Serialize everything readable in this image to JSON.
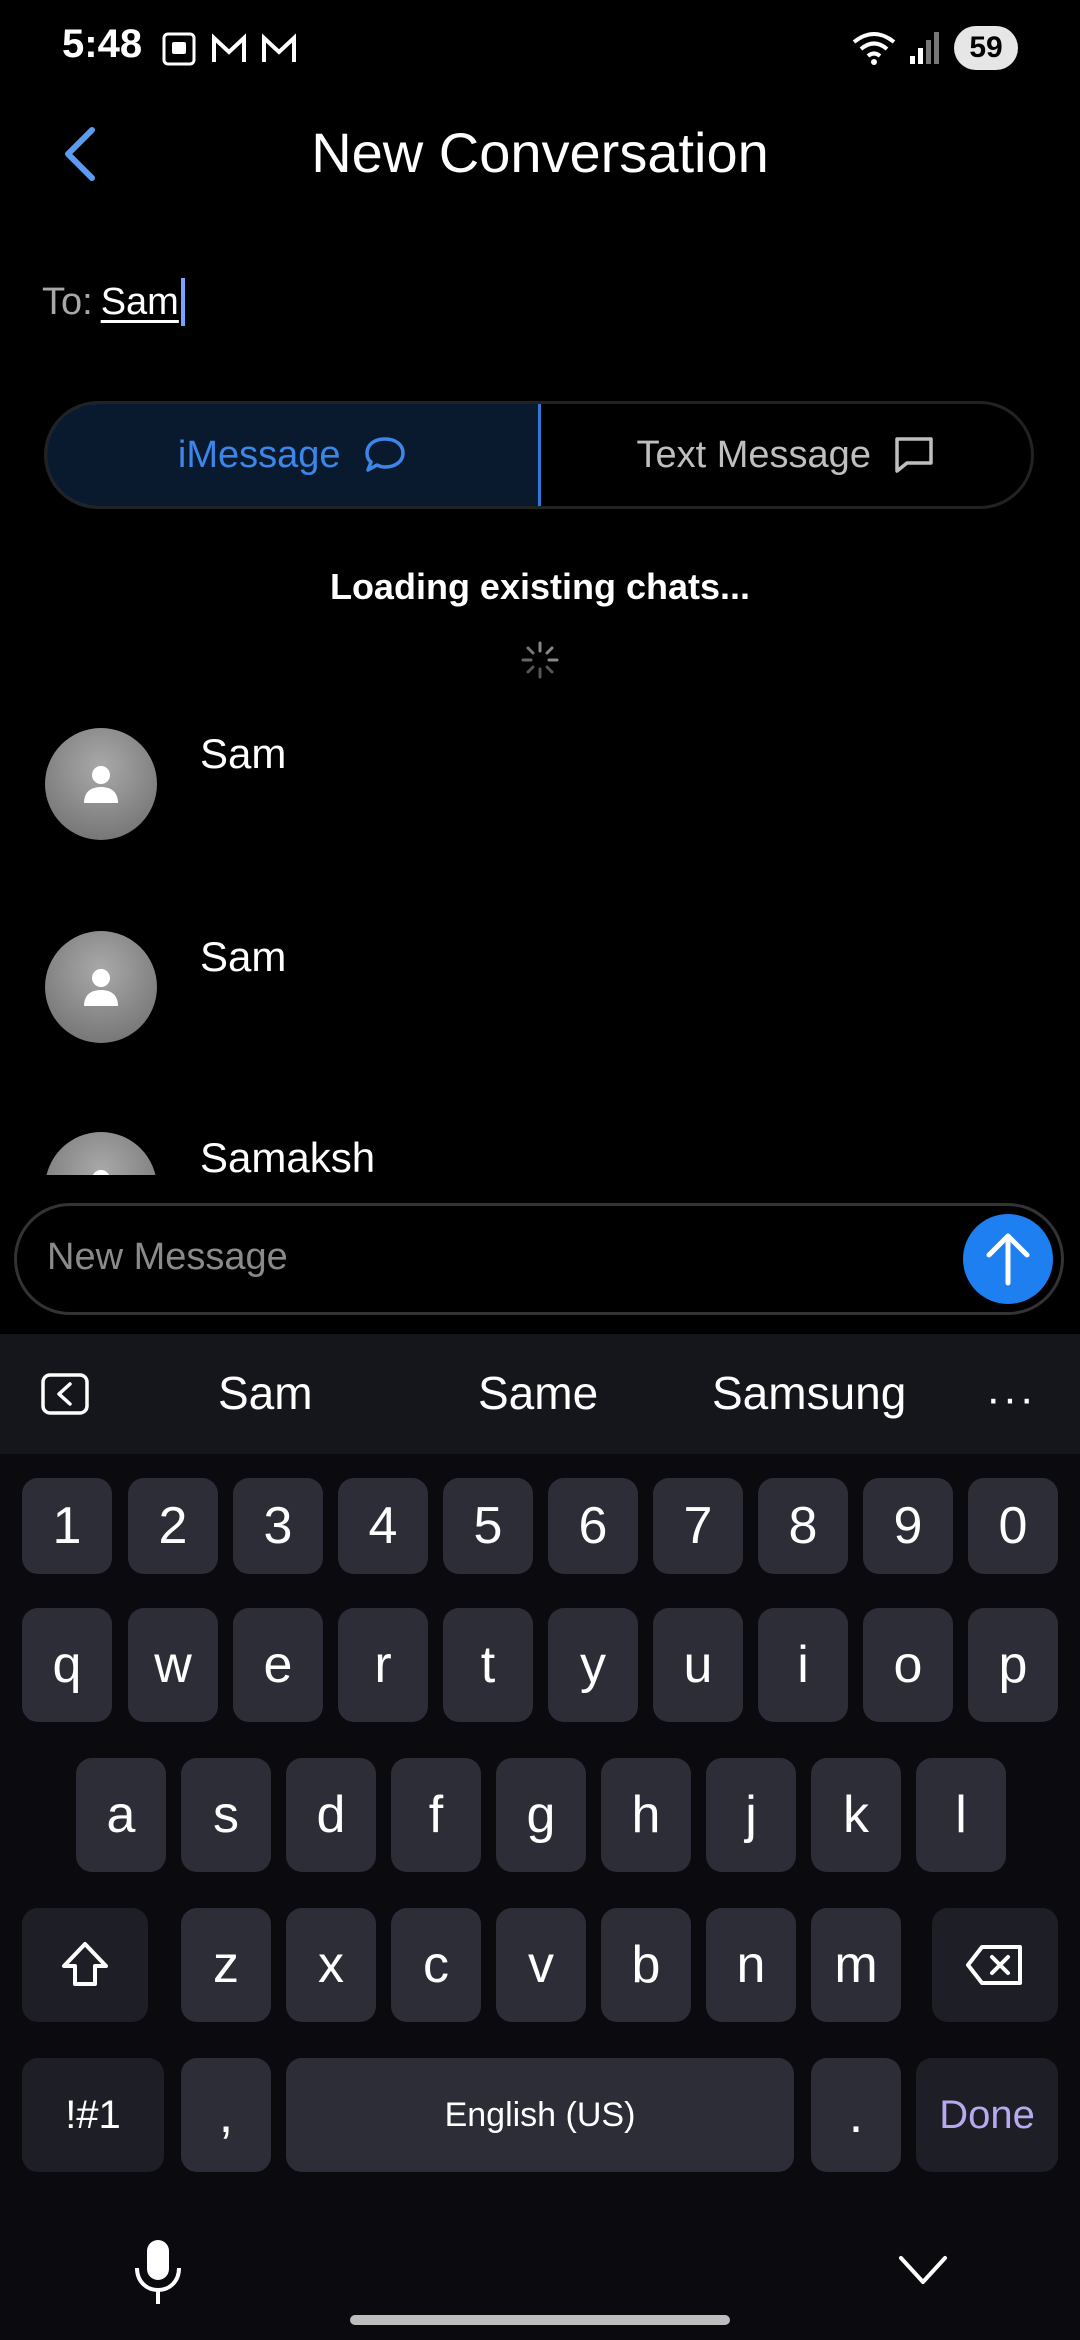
{
  "status_bar": {
    "time": "5:48",
    "battery": "59"
  },
  "header": {
    "title": "New Conversation"
  },
  "to_field": {
    "label": "To:",
    "value": "Sam"
  },
  "tabs": [
    {
      "label": "iMessage",
      "active": true
    },
    {
      "label": "Text Message",
      "active": false
    }
  ],
  "loading": {
    "text": "Loading existing chats..."
  },
  "contacts": [
    {
      "name": "Sam"
    },
    {
      "name": "Sam"
    },
    {
      "name": "Samaksh"
    }
  ],
  "composer": {
    "placeholder": "New Message"
  },
  "keyboard": {
    "suggestions": [
      "Sam",
      "Same",
      "Samsung"
    ],
    "more": "···",
    "row_numbers": [
      "1",
      "2",
      "3",
      "4",
      "5",
      "6",
      "7",
      "8",
      "9",
      "0"
    ],
    "row_q": [
      "q",
      "w",
      "e",
      "r",
      "t",
      "y",
      "u",
      "i",
      "o",
      "p"
    ],
    "row_a": [
      "a",
      "s",
      "d",
      "f",
      "g",
      "h",
      "j",
      "k",
      "l"
    ],
    "row_z": [
      "z",
      "x",
      "c",
      "v",
      "b",
      "n",
      "m"
    ],
    "symbols_label": "!#1",
    "comma_label": ",",
    "space_label": "English (US)",
    "period_label": ".",
    "done_label": "Done"
  },
  "colors": {
    "accent": "#1e7ff0",
    "tab_active_text": "#3b86e8",
    "done_text": "#b7a9f0"
  }
}
